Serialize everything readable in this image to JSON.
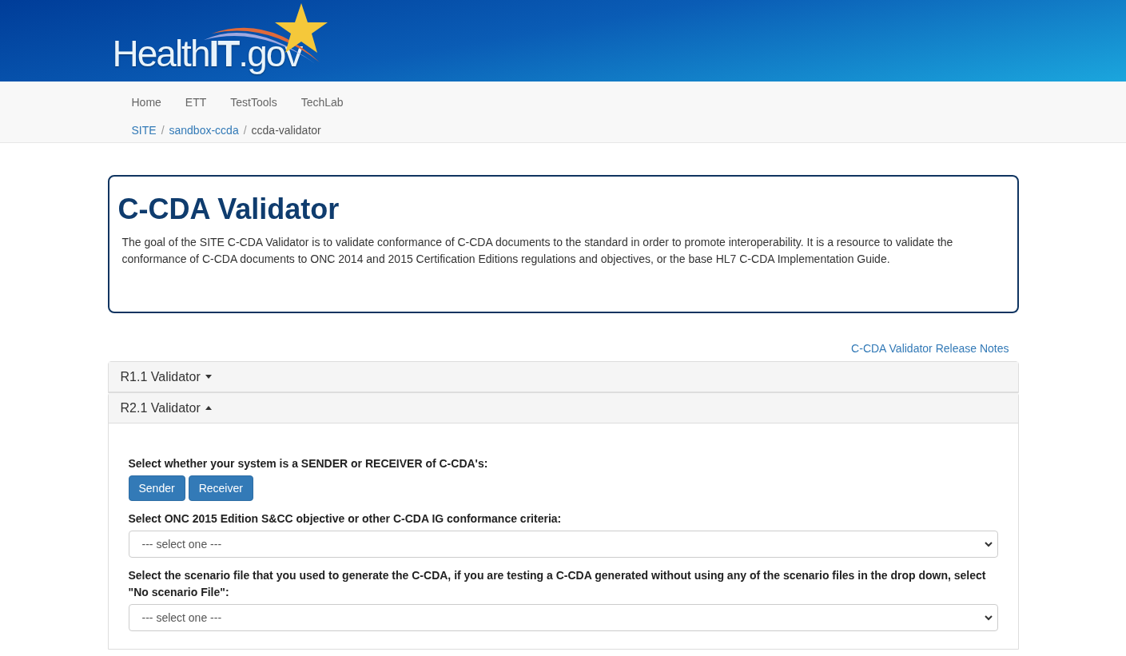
{
  "logo": {
    "parts": [
      "Health",
      "IT",
      ".gov"
    ]
  },
  "nav": {
    "items": [
      "Home",
      "ETT",
      "TestTools",
      "TechLab"
    ]
  },
  "breadcrumb": [
    {
      "label": "SITE",
      "link": true,
      "separator": "/"
    },
    {
      "label": "sandbox-ccda",
      "link": true,
      "separator": "/"
    },
    {
      "label": "ccda-validator",
      "link": false
    }
  ],
  "intro": {
    "title": "C-CDA Validator",
    "text": "The goal of the SITE C-CDA Validator is to validate conformance of C-CDA documents to the standard in order to promote interoperability. It is a resource to validate the conformance of C-CDA documents to ONC 2014 and 2015 Certification Editions regulations and objectives, or the base HL7 C-CDA Implementation Guide."
  },
  "release_notes_link": "C-CDA Validator Release Notes",
  "panels": [
    {
      "title": "R1.1 Validator",
      "expanded": false
    },
    {
      "title": "R2.1 Validator",
      "expanded": true,
      "fields": [
        {
          "kind": "buttons",
          "label": "Select whether your system is a SENDER or RECEIVER of C-CDA's:",
          "buttons": [
            "Sender",
            "Receiver"
          ]
        },
        {
          "kind": "select",
          "label": "Select ONC 2015 Edition S&CC objective or other C-CDA IG conformance criteria:",
          "value": "--- select one ---"
        },
        {
          "kind": "select",
          "label": "Select the scenario file that you used to generate the C-CDA, if you are testing a C-CDA generated without using any of the scenario files in the drop down, select \"No scenario File\":",
          "value": "--- select one ---"
        }
      ]
    }
  ]
}
